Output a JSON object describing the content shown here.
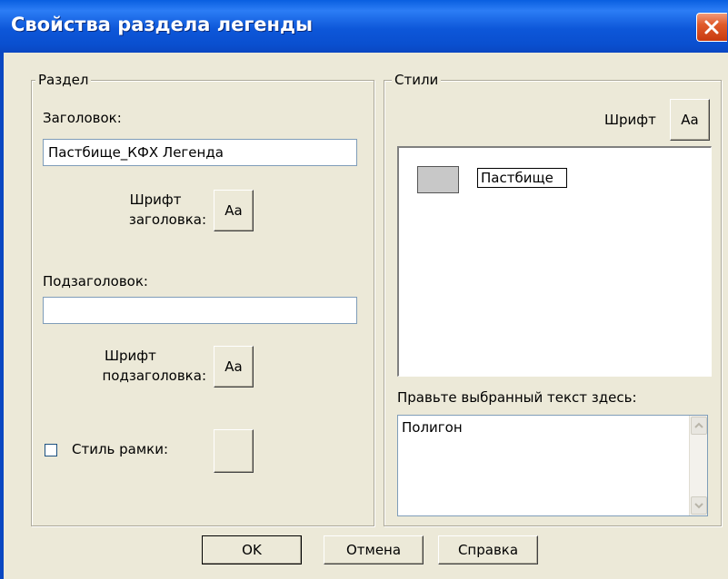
{
  "window": {
    "title": "Свойства раздела легенды"
  },
  "section_group": {
    "legend": "Раздел",
    "title_label": "Заголовок:",
    "title_value": "Пастбище_КФХ Легенда",
    "title_font_label_line1": "Шрифт",
    "title_font_label_line2": "заголовка:",
    "title_font_button": "Aa",
    "subtitle_label": "Подзаголовок:",
    "subtitle_value": "",
    "subtitle_font_label_line1": "Шрифт",
    "subtitle_font_label_line2": "подзаголовка:",
    "subtitle_font_button": "Aa",
    "frame_style_label": "Стиль рамки:",
    "frame_style_checked": false
  },
  "styles_group": {
    "legend": "Стили",
    "font_label": "Шрифт",
    "font_button": "Aa",
    "items": [
      {
        "label": "Пастбище",
        "swatch_color": "#c8c8c8"
      }
    ],
    "edit_label": "Правьте выбранный текст здесь:",
    "edit_value": "Полигон"
  },
  "buttons": {
    "ok": "OK",
    "cancel": "Отмена",
    "help": "Справка"
  },
  "icons": {
    "close": "close-icon",
    "scroll_up": "arrow-up-icon",
    "scroll_down": "arrow-down-icon"
  },
  "colors": {
    "titlebar": "#0a5fe0",
    "close_button": "#e05a2a",
    "dialog_bg": "#ece9d8"
  }
}
